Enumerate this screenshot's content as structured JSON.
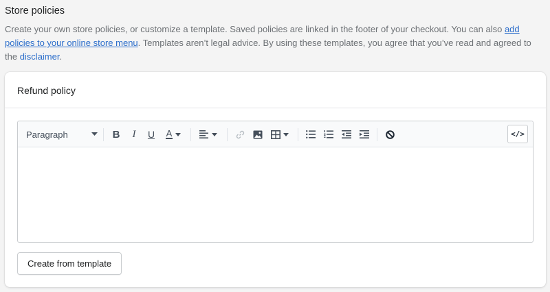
{
  "section": {
    "title": "Store policies",
    "desc_part1": "Create your own store policies, or customize a template. Saved policies are linked in the footer of your checkout. You can also ",
    "desc_link1": "add policies to your online store menu",
    "desc_part2": ". Templates aren’t legal advice. By using these templates, you agree that you’ve read and agreed to the ",
    "desc_link2": "disclaimer",
    "desc_part3": "."
  },
  "card": {
    "title": "Refund policy"
  },
  "toolbar": {
    "format_select": "Paragraph",
    "bold": "B",
    "italic": "I",
    "underline": "U",
    "text_color": "A",
    "code_button": "</>"
  },
  "editor": {
    "content": ""
  },
  "actions": {
    "create_from_template": "Create from template"
  },
  "colors": {
    "link": "#2c6ecb",
    "background": "#f4f4f4",
    "card": "#ffffff"
  },
  "icons": [
    "dropdown-caret-icon",
    "align-left-icon",
    "link-icon",
    "image-icon",
    "table-icon",
    "bulleted-list-icon",
    "numbered-list-icon",
    "outdent-icon",
    "indent-icon",
    "clear-formatting-icon"
  ]
}
